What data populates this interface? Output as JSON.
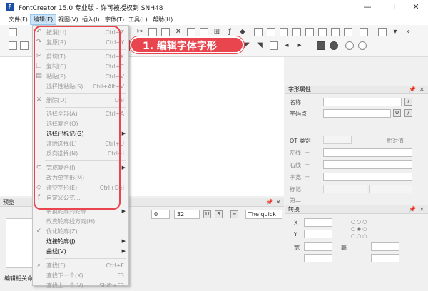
{
  "window": {
    "title": "FontCreator 15.0 专业版 - 许可被授权到 SNH48",
    "icon": "fontcreator-app-icon",
    "min": "—",
    "max": "☐",
    "close": "✕"
  },
  "menubar": {
    "items": [
      {
        "label": "文件(F)"
      },
      {
        "label": "编辑(E)"
      },
      {
        "label": "视图(V)"
      },
      {
        "label": "插入(I)"
      },
      {
        "label": "字体(T)"
      },
      {
        "label": "工具(L)"
      },
      {
        "label": "帮助(H)"
      }
    ]
  },
  "annotation": {
    "text": "1. 编辑字体字形",
    "color": "#e8454f"
  },
  "edit_menu": {
    "items": [
      {
        "label": "撤消(U)",
        "shortcut": "Ctrl+Z",
        "icon": "undo-icon",
        "enabled": false
      },
      {
        "label": "复原(R)",
        "shortcut": "Ctrl+Y",
        "icon": "redo-icon",
        "enabled": false
      },
      {
        "label": "剪切(T)",
        "shortcut": "Ctrl+X",
        "icon": "cut-icon",
        "enabled": false
      },
      {
        "label": "复制(C)",
        "shortcut": "Ctrl+C",
        "icon": "copy-icon",
        "enabled": false
      },
      {
        "label": "粘贴(P)",
        "shortcut": "Ctrl+V",
        "icon": "paste-icon",
        "enabled": false
      },
      {
        "label": "选择性粘贴(S)...",
        "shortcut": "Ctrl+Alt+V",
        "icon": "",
        "enabled": false
      },
      {
        "label": "删除(D)",
        "shortcut": "Del",
        "icon": "delete-icon",
        "enabled": false
      },
      {
        "label": "选择全部(A)",
        "shortcut": "Ctrl+A",
        "icon": "",
        "enabled": false
      },
      {
        "label": "选择复合(O)",
        "shortcut": "",
        "icon": "",
        "enabled": false
      },
      {
        "label": "选择已标记(G)",
        "shortcut": "",
        "icon": "",
        "enabled": true,
        "submenu": true
      },
      {
        "label": "清除选择(L)",
        "shortcut": "Ctrl+U",
        "icon": "",
        "enabled": false
      },
      {
        "label": "反向选择(N)",
        "shortcut": "Ctrl+I",
        "icon": "",
        "enabled": false
      },
      {
        "label": "完成复合(I)",
        "shortcut": "",
        "icon": "link-icon",
        "enabled": false,
        "submenu": true
      },
      {
        "label": "改为单字形(M)",
        "shortcut": "",
        "icon": "",
        "enabled": false
      },
      {
        "label": "清空字形(E)",
        "shortcut": "Ctrl+Del",
        "icon": "clear-glyph-icon",
        "enabled": false
      },
      {
        "label": "自定义公式...",
        "shortcut": "",
        "icon": "fx-icon",
        "enabled": false
      },
      {
        "label": "转换轮廓到轮廓",
        "shortcut": "",
        "icon": "",
        "enabled": false,
        "submenu": true
      },
      {
        "label": "改变轮廓线方向(H)",
        "shortcut": "",
        "icon": "",
        "enabled": false
      },
      {
        "label": "优化轮廓(Z)",
        "shortcut": "",
        "icon": "optimize-icon",
        "enabled": false
      },
      {
        "label": "连接轮廓(J)",
        "shortcut": "",
        "icon": "",
        "enabled": true,
        "submenu": true
      },
      {
        "label": "曲线(V)",
        "shortcut": "",
        "icon": "",
        "enabled": true,
        "submenu": true
      },
      {
        "label": "查找(F)...",
        "shortcut": "Ctrl+F",
        "icon": "find-icon",
        "enabled": false
      },
      {
        "label": "查找下一个(X)",
        "shortcut": "F3",
        "icon": "",
        "enabled": false
      },
      {
        "label": "查找上一个(V)",
        "shortcut": "Shift+F3",
        "icon": "",
        "enabled": false
      }
    ]
  },
  "glyph_properties": {
    "title": "字形属性",
    "name_label": "名称",
    "codepoint_label": "字码点",
    "ot_class_label": "OT 类别",
    "relative_label": "相对值",
    "left_label": "左线",
    "left_suffix": "--",
    "right_label": "右线",
    "right_suffix": "--",
    "width_label": "字宽",
    "width_suffix": "--",
    "mark_label": "标记",
    "more_label": "第二"
  },
  "transform_panel": {
    "title": "转换",
    "x_label": "X",
    "y_label": "Y",
    "width_label": "宽",
    "height_label": "高"
  },
  "preview_panel": {
    "title": "预览",
    "size_value": "0",
    "size2_value": "32",
    "sample_text": "The quick"
  },
  "statusbar": {
    "left_text": "编辑相关命"
  }
}
